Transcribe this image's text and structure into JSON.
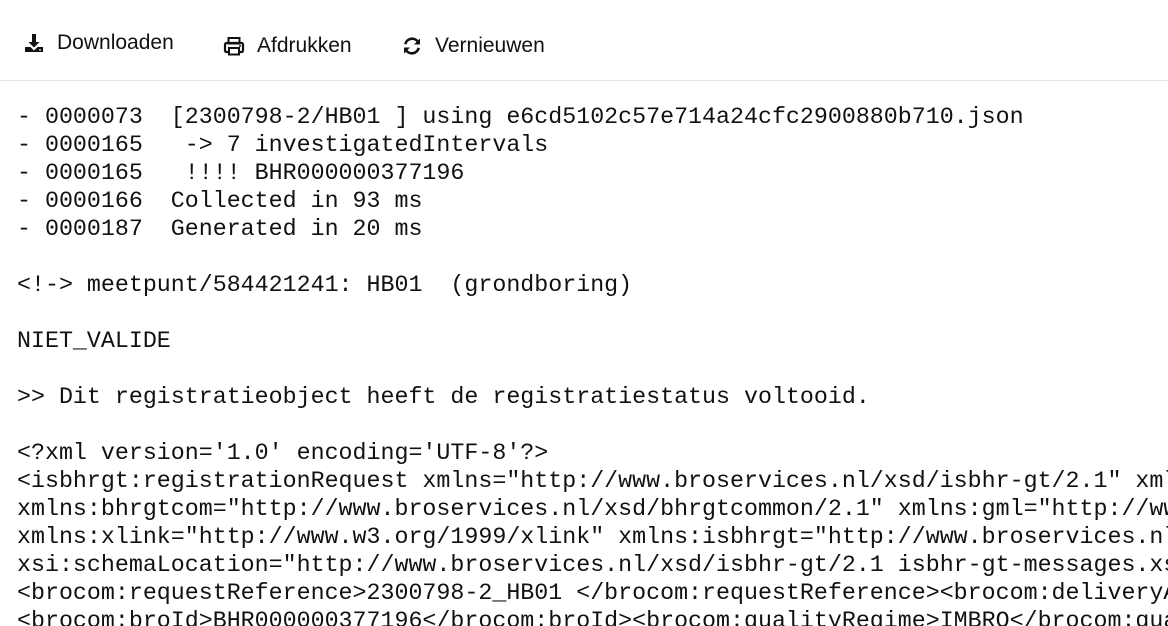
{
  "toolbar": {
    "download_label": "Downloaden",
    "print_label": "Afdrukken",
    "refresh_label": "Vernieuwen",
    "icons": [
      "download-icon",
      "printer-icon",
      "refresh-icon"
    ]
  },
  "log": {
    "lines": [
      "- 0000073  [2300798-2/HB01 ] using e6cd5102c57e714a24cfc2900880b710.json",
      "- 0000165   -> 7 investigatedIntervals",
      "- 0000165   !!!! BHR000000377196",
      "- 0000166  Collected in 93 ms",
      "- 0000187  Generated in 20 ms",
      "",
      "<!-> meetpunt/584421241: HB01  (grondboring)",
      "",
      "NIET_VALIDE",
      "",
      ">> Dit registratieobject heeft de registratiestatus voltooid.",
      "",
      "<?xml version='1.0' encoding='UTF-8'?>",
      "<isbhrgt:registrationRequest xmlns=\"http://www.broservices.nl/xsd/isbhr-gt/2.1\" xmlns",
      "xmlns:bhrgtcom=\"http://www.broservices.nl/xsd/bhrgtcommon/2.1\" xmlns:gml=\"http://www",
      "xmlns:xlink=\"http://www.w3.org/1999/xlink\" xmlns:isbhrgt=\"http://www.broservices.nl",
      "xsi:schemaLocation=\"http://www.broservices.nl/xsd/isbhr-gt/2.1 isbhr-gt-messages.xsd",
      "<brocom:requestReference>2300798-2_HB01 </brocom:requestReference><brocom:deliveryA",
      "<brocom:broId>BHR000000377196</brocom:broId><brocom:qualityRegime>IMBRO</brocom:qua"
    ]
  }
}
